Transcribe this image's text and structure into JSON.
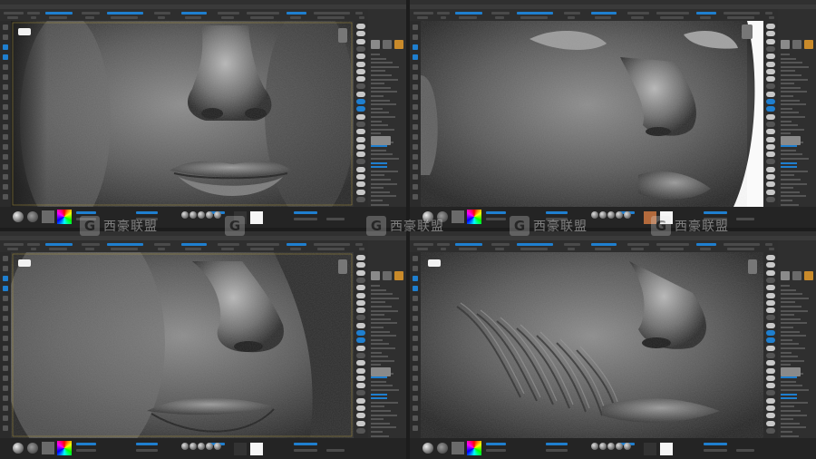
{
  "panels": [
    {
      "titlebar": "",
      "viewport_bg": "dark",
      "menu": [
        "",
        "",
        "",
        "",
        "",
        "",
        "",
        "",
        ""
      ]
    },
    {
      "titlebar": "",
      "viewport_bg": "white",
      "menu": [
        "",
        "",
        "",
        "",
        "",
        "",
        "",
        "",
        ""
      ]
    },
    {
      "titlebar": "",
      "viewport_bg": "dark",
      "menu": [
        "",
        "",
        "",
        "",
        "",
        "",
        "",
        "",
        ""
      ]
    },
    {
      "titlebar": "",
      "viewport_bg": "dark",
      "menu": [
        "",
        "",
        "",
        "",
        "",
        "",
        "",
        "",
        ""
      ]
    }
  ],
  "watermark": {
    "logo_letter": "G",
    "text": "西豪联盟"
  },
  "colors": {
    "accent": "#1f7fcf",
    "viewport_dark": "#333333",
    "viewport_white": "#fafafa",
    "matcap": "#8a8a8a"
  },
  "icons": [
    "gizmo-icon",
    "head-preview-icon",
    "color-picker-icon",
    "brush-ball-icon",
    "material-ball-icon"
  ]
}
